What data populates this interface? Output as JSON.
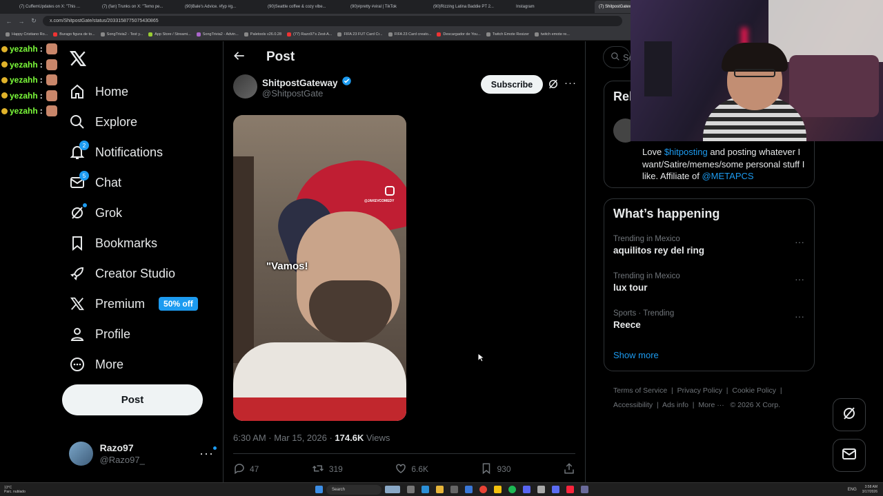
{
  "browser": {
    "tabs": [
      "(7) CuffemUpdates on X: \"This ...",
      "(7) (fan) Trunks on X: \"Temo pe...",
      "(90)Bale's Advice. #fyp #g...",
      "(90)Seattle coffee & cozy vibe...",
      "(90)#pretty #viral | TikTok",
      "(90)Rizzing Latina Baddie PT 2...",
      "Instagram",
      "(7) ShitpostGatew..."
    ],
    "url": "x.com/ShitpostGate/status/2033158775075430865",
    "bookmarks": [
      "Happy Cristiano Ro...",
      "Burago figura de to...",
      "SongTrivia2 - Test y...",
      "App Store / Streami...",
      "SongTrivia2 - Advin...",
      "Paletools v26.0.28",
      "(77) Razo97's Zest-A...",
      "FIFA 23 FUT Card Cr...",
      "FIFA 23 Card creato...",
      "Descargador de You...",
      "Twitch Emote Resizer",
      "twitch emote re..."
    ]
  },
  "chat": {
    "messages": [
      {
        "user": "yezahh",
        "sep": ":"
      },
      {
        "user": "yezahh",
        "sep": ":"
      },
      {
        "user": "yezahh",
        "sep": ":"
      },
      {
        "user": "yezahh",
        "sep": ":"
      },
      {
        "user": "yezahh",
        "sep": ":"
      }
    ]
  },
  "nav": {
    "items": [
      {
        "label": "Home",
        "icon": "home-icon"
      },
      {
        "label": "Explore",
        "icon": "search-icon"
      },
      {
        "label": "Notifications",
        "icon": "bell-icon",
        "badge": "2"
      },
      {
        "label": "Chat",
        "icon": "mail-icon",
        "badge": "5"
      },
      {
        "label": "Grok",
        "icon": "grok-icon"
      },
      {
        "label": "Bookmarks",
        "icon": "bookmark-icon"
      },
      {
        "label": "Creator Studio",
        "icon": "rocket-icon"
      },
      {
        "label": "Premium",
        "icon": "x-logo-icon",
        "badge": "50% off"
      },
      {
        "label": "Profile",
        "icon": "person-icon"
      },
      {
        "label": "More",
        "icon": "more-circle-icon"
      }
    ],
    "post_button": "Post",
    "account": {
      "name": "Razo97",
      "handle": "@Razo97_"
    }
  },
  "post": {
    "header_title": "Post",
    "author_name": "ShitpostGateway",
    "author_handle": "@ShitpostGate",
    "subscribe_label": "Subscribe",
    "video_caption": "\"Vamos!",
    "video_watermark": "@JAKEVCOMEDY",
    "time": "6:30 AM · Mar 15, 2026 · ",
    "views_count": "174.6K",
    "views_label": " Views",
    "replies": "47",
    "reposts": "319",
    "likes": "6.6K",
    "bookmarks": "930"
  },
  "sidebar": {
    "search_placeholder": "Se",
    "relevant_title": "Rel",
    "bio_pre": "Love ",
    "bio_tag": "$hitposting",
    "bio_mid": " and posting whatever I want/Satire/memes/some personal stuff I like. Affiliate of ",
    "bio_link": "@METAPCS",
    "happening_title": "What’s happening",
    "trends": [
      {
        "context": "Trending in Mexico",
        "name": "aquilitos rey del ring"
      },
      {
        "context": "Trending in Mexico",
        "name": "lux tour"
      },
      {
        "context": "Sports · Trending",
        "name": "Reece"
      }
    ],
    "show_more": "Show more",
    "footer": {
      "terms": "Terms of Service",
      "privacy": "Privacy Policy",
      "cookie": "Cookie Policy",
      "accessibility": "Accessibility",
      "ads": "Ads info",
      "more": "More ···",
      "copyright": "© 2026 X Corp."
    }
  },
  "taskbar": {
    "weather_temp": "13°C",
    "weather_desc": "Parc. nublado",
    "search": "Search",
    "lang": "ENG",
    "time": "3:58 AM",
    "date": "3/17/2026"
  },
  "colors": {
    "accent": "#1d9bf0",
    "background": "#000000",
    "chat_name": "#7cfc3a"
  }
}
